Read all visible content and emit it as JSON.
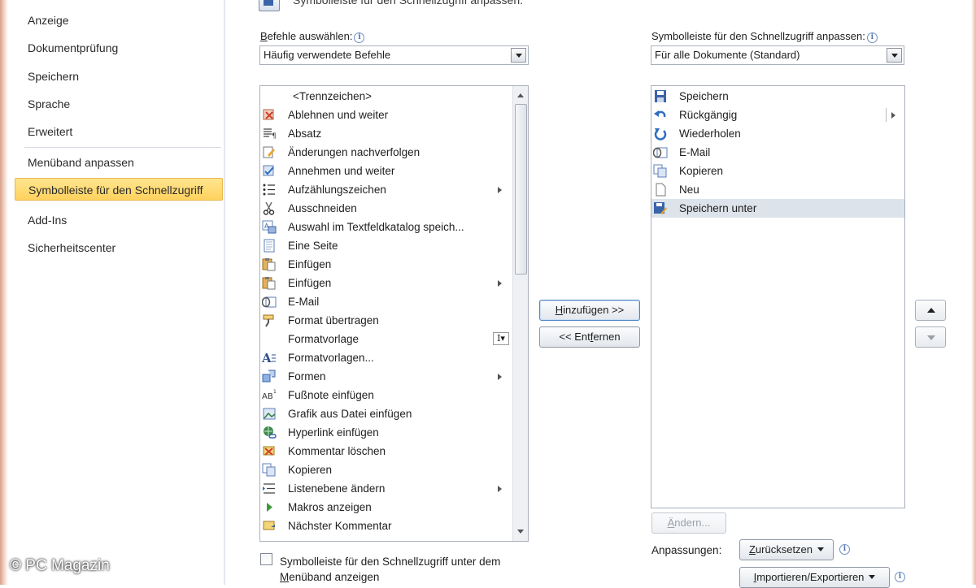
{
  "header": {
    "title": "Symbolleiste für den Schnellzugriff anpassen."
  },
  "sidebar": {
    "items": [
      {
        "label": "Anzeige"
      },
      {
        "label": "Dokumentprüfung"
      },
      {
        "label": "Speichern"
      },
      {
        "label": "Sprache"
      },
      {
        "label": "Erweitert"
      },
      {
        "label": "Menüband anpassen"
      },
      {
        "label": "Symbolleiste für den Schnellzugriff",
        "selected": true
      },
      {
        "label": "Add-Ins"
      },
      {
        "label": "Sicherheitscenter"
      }
    ]
  },
  "commands": {
    "label": "Befehle auswählen:",
    "select_value": "Häufig verwendete Befehle",
    "items": [
      {
        "label": "<Trennzeichen>",
        "icon": "separator"
      },
      {
        "label": "Ablehnen und weiter",
        "icon": "reject-icon"
      },
      {
        "label": "Absatz",
        "icon": "paragraph-icon"
      },
      {
        "label": "Änderungen nachverfolgen",
        "icon": "track-changes-icon"
      },
      {
        "label": "Annehmen und weiter",
        "icon": "accept-icon"
      },
      {
        "label": "Aufzählungszeichen",
        "icon": "bullets-icon",
        "submenu": true
      },
      {
        "label": "Ausschneiden",
        "icon": "scissors-icon"
      },
      {
        "label": "Auswahl im Textfeldkatalog speich...",
        "icon": "textbox-icon"
      },
      {
        "label": "Eine Seite",
        "icon": "page-icon"
      },
      {
        "label": "Einfügen",
        "icon": "paste-icon"
      },
      {
        "label": "Einfügen",
        "icon": "paste-icon",
        "submenu": true
      },
      {
        "label": "E-Mail",
        "icon": "email-icon"
      },
      {
        "label": "Format übertragen",
        "icon": "format-painter-icon"
      },
      {
        "label": "Formatvorlage",
        "icon": "none",
        "combo": true
      },
      {
        "label": "Formatvorlagen...",
        "icon": "styles-icon"
      },
      {
        "label": "Formen",
        "icon": "shapes-icon",
        "submenu": true
      },
      {
        "label": "Fußnote einfügen",
        "icon": "footnote-icon"
      },
      {
        "label": "Grafik aus Datei einfügen",
        "icon": "picture-icon"
      },
      {
        "label": "Hyperlink einfügen",
        "icon": "hyperlink-icon"
      },
      {
        "label": "Kommentar löschen",
        "icon": "delete-comment-icon"
      },
      {
        "label": "Kopieren",
        "icon": "copy-icon"
      },
      {
        "label": "Listenebene ändern",
        "icon": "list-level-icon",
        "submenu": true
      },
      {
        "label": "Makros anzeigen",
        "icon": "macro-icon"
      },
      {
        "label": "Nächster Kommentar",
        "icon": "next-comment-icon"
      }
    ]
  },
  "toolbar": {
    "label": "Symbolleiste für den Schnellzugriff anpassen:",
    "select_value": "Für alle Dokumente (Standard)",
    "items": [
      {
        "label": "Speichern",
        "icon": "save-icon"
      },
      {
        "label": "Rückgängig",
        "icon": "undo-icon",
        "submenu": true
      },
      {
        "label": "Wiederholen",
        "icon": "redo-icon"
      },
      {
        "label": "E-Mail",
        "icon": "email-icon"
      },
      {
        "label": "Kopieren",
        "icon": "copy-icon"
      },
      {
        "label": "Neu",
        "icon": "new-document-icon"
      },
      {
        "label": "Speichern unter",
        "icon": "save-as-icon",
        "selected": true
      }
    ]
  },
  "buttons": {
    "add_prefix": "",
    "add_u": "H",
    "add_rest": "inzufügen >>",
    "remove_prefix": "<< Ent",
    "remove_u": "f",
    "remove_rest": "ernen",
    "modify_u": "Ä",
    "modify_rest": "ndern...",
    "reset_u": "Z",
    "reset_rest": "urücksetzen",
    "import_u": "I",
    "import_rest": "mportieren/Exportieren"
  },
  "customizations_label": "Anpassungen:",
  "checkbox": {
    "line1": "Symbolleiste für den Schnellzugriff unter dem",
    "line2_u": "M",
    "line2_rest": "enüband anzeigen",
    "checked": false
  },
  "watermark": "© PC Magazin",
  "colors": {
    "selection_yellow": "#ffd25e",
    "selected_row": "#dde3ea",
    "accent_blue": "#3a64a8"
  }
}
